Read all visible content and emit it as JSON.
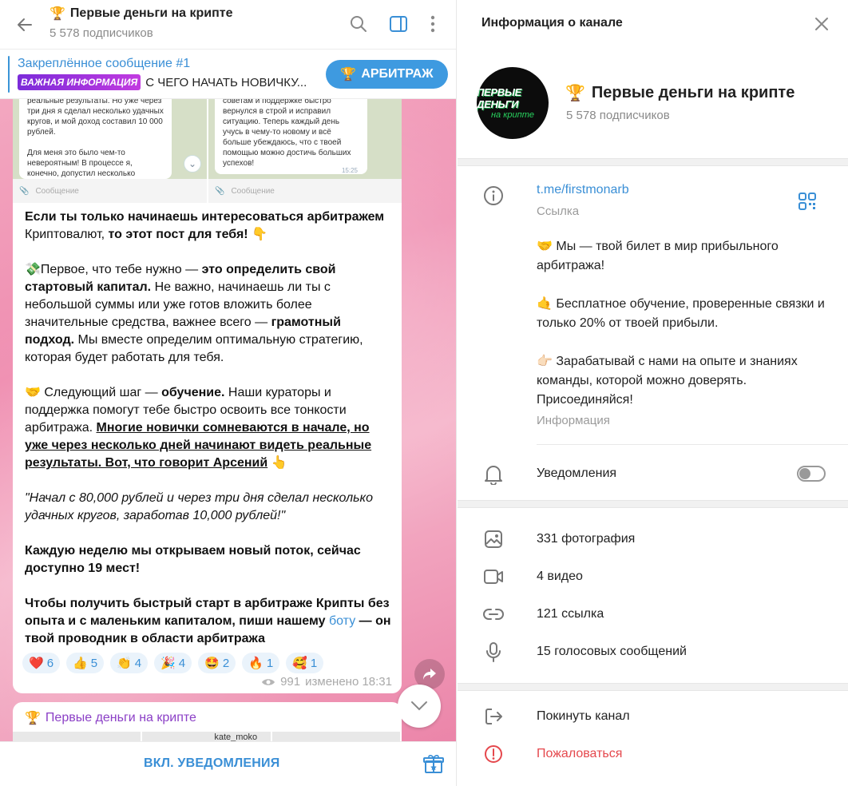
{
  "chat": {
    "channel_emoji": "🏆",
    "channel_title": "Первые деньги на крипте",
    "subscribers": "5 578 подписчиков",
    "pinned": {
      "title": "Закреплённое сообщение #1",
      "badge": "ВАЖНАЯ ИНФОРМАЦИЯ",
      "text": "С ЧЕГО НАЧАТЬ НОВИЧКУ...",
      "button_label": "АРБИТРАЖ",
      "button_emoji": "🏆"
    },
    "screenshots": {
      "left_text": "реальные результаты. Но уже через три дня я сделал несколько удачных кругов, и мой доход составил 10 000 рублей.\n\nДля меня это было чем-то невероятным! В процессе я, конечно, допустил несколько",
      "right_text": "советам и поддержке быстро вернулся в строй и исправил ситуацию. Теперь каждый день учусь в чему-то новому и всё больше убеждаюсь, что с твоей помощью можно достичь больших успехов!",
      "right_time": "15:25",
      "input_placeholder": "Сообщение"
    },
    "message": {
      "p1_bold": "Если ты только начинаешь интересоваться арбитражем",
      "p1_normal": " Криптовалют, ",
      "p1_bold2": "то этот пост для тебя!",
      "p1_emoji": " 👇",
      "p2_emoji": "💸",
      "p2_normal": "Первое, что тебе нужно — ",
      "p2_bold": "это определить свой стартовый капитал.",
      "p2_normal2": " Не важно, начинаешь ли ты с небольшой суммы или уже готов вложить более значительные средства, важнее всего — ",
      "p2_bold2": "грамотный подход.",
      "p2_normal3": " Мы вместе определим оптимальную стратегию, которая будет работать для тебя.",
      "p3_emoji": "🤝",
      "p3_normal": " Следующий шаг — ",
      "p3_bold": "обучение.",
      "p3_normal2": " Наши кураторы и поддержка помогут тебе быстро освоить все тонкости арбитража. ",
      "p3_underline": "Многие новички сомневаются в начале, но уже через несколько дней начинают видеть реальные результаты. Вот, что говорит Арсений",
      "p3_emoji2": " 👆",
      "quote": "\"Начал с 80,000 рублей и через три дня сделал несколько удачных кругов, заработав 10,000 рублей!\"",
      "p4_bold": "Каждую неделю мы открываем новый поток, сейчас доступно 19 мест!",
      "p5_bold": "Чтобы получить быстрый старт в арбитраже Крипты без опыта и с маленьким капиталом, пиши нашему ",
      "p5_link": "боту",
      "p5_bold2": " — он твой проводник в области арбитража"
    },
    "reactions": [
      {
        "emoji": "❤️",
        "count": "6"
      },
      {
        "emoji": "👍",
        "count": "5"
      },
      {
        "emoji": "👏",
        "count": "4"
      },
      {
        "emoji": "🎉",
        "count": "4"
      },
      {
        "emoji": "🤩",
        "count": "2"
      },
      {
        "emoji": "🔥",
        "count": "1"
      },
      {
        "emoji": "🥰",
        "count": "1"
      }
    ],
    "views": "991",
    "edited": "изменено 18:31",
    "next_message": {
      "sender_emoji": "🏆",
      "sender": "Первые деньги на крипте",
      "preview_text": "kate_moko"
    },
    "footer_button": "ВКЛ. УВЕДОМЛЕНИЯ"
  },
  "info": {
    "header_title": "Информация о канале",
    "avatar_line1": "ПЕРВЫЕ ДЕНЬГИ",
    "avatar_line2": "на крипте",
    "name_emoji": "🏆",
    "name": "Первые деньги на крипте",
    "subscribers": "5 578 подписчиков",
    "link": "t.me/firstmonarb",
    "link_label": "Ссылка",
    "description": {
      "l1_emoji": "🤝",
      "l1": " Мы — твой билет в мир прибыльного арбитража!",
      "l2_emoji": "🤙",
      "l2": " Бесплатное обучение, проверенные связки и только 20% от твоей прибыли.",
      "l3_emoji": "👉🏻",
      "l3": " Зарабатывай с нами на опыте и знаниях команды, которой можно доверять. Присоединяйся!"
    },
    "description_label": "Информация",
    "notifications_label": "Уведомления",
    "notifications_on": false,
    "media": [
      {
        "icon": "photo-icon",
        "label": "331 фотография"
      },
      {
        "icon": "video-icon",
        "label": "4 видео"
      },
      {
        "icon": "link-icon",
        "label": "121 ссылка"
      },
      {
        "icon": "microphone-icon",
        "label": "15 голосовых сообщений"
      }
    ],
    "leave_label": "Покинуть канал",
    "report_label": "Пожаловаться"
  }
}
